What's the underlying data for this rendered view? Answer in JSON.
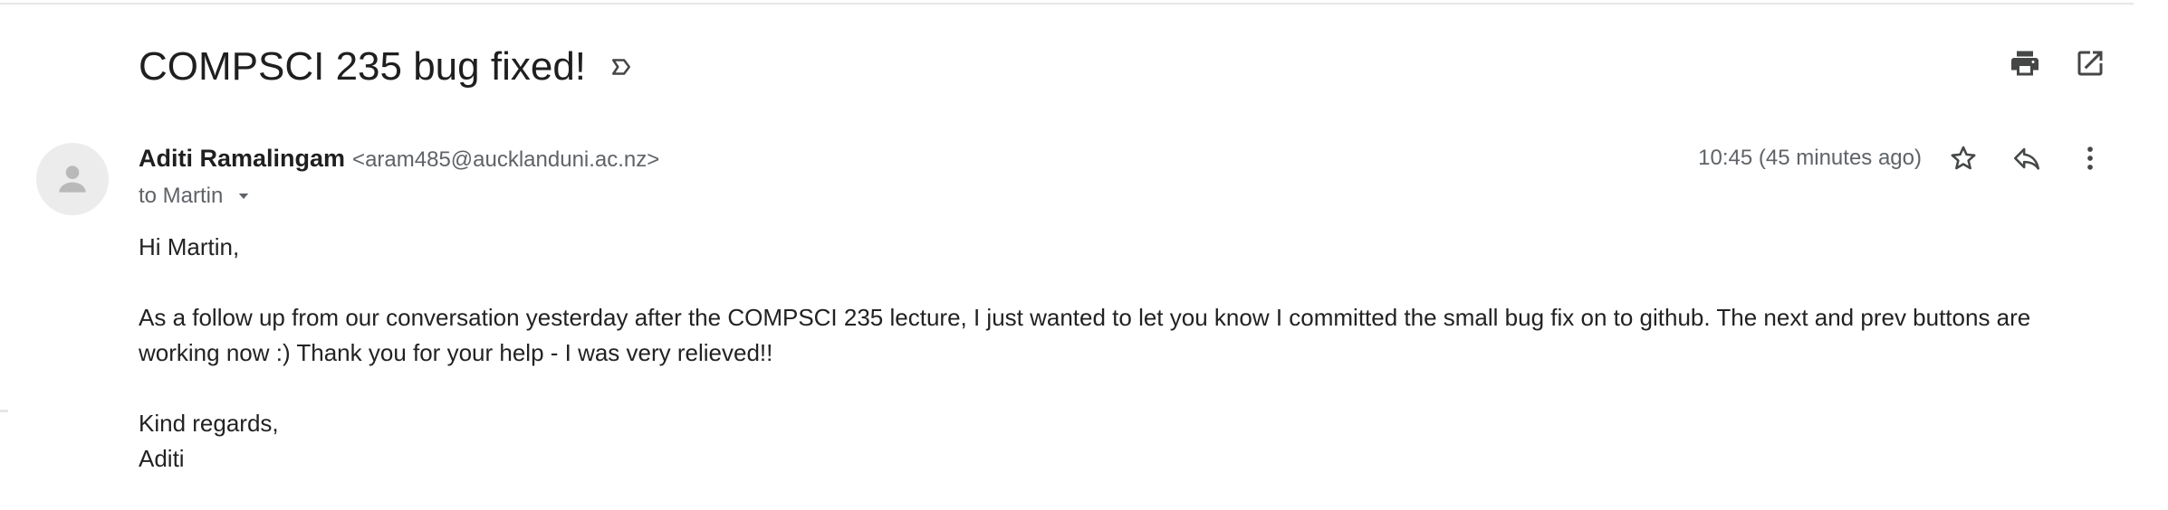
{
  "email": {
    "subject": "COMPSCI 235 bug fixed!",
    "sender_name": "Aditi Ramalingam",
    "sender_email": "<aram485@aucklanduni.ac.nz>",
    "recipient": "to Martin",
    "timestamp": "10:45 (45 minutes ago)",
    "body": {
      "greeting": "Hi Martin,",
      "paragraph_line1": "As a follow up from our conversation yesterday after the COMPSCI 235 lecture, I just wanted to let you know I committed the small bug fix on to github. The next and prev buttons are",
      "paragraph_line2": "working now :) Thank you for your help - I was very relieved!!",
      "closing": "Kind regards,",
      "signature": "Aditi"
    }
  },
  "icons": {
    "label": "label-outline-icon",
    "print": "print-icon",
    "open_new": "open-in-new-window-icon",
    "avatar": "person-icon",
    "caret": "dropdown-caret-icon",
    "star": "star-outline-icon",
    "reply": "reply-icon",
    "more": "more-vertical-icon"
  },
  "colors": {
    "text": "#1f1f1f",
    "muted": "#5f6368",
    "icon": "#444746",
    "avatar_bg": "#ececec",
    "avatar_fg": "#b9b9b9"
  }
}
